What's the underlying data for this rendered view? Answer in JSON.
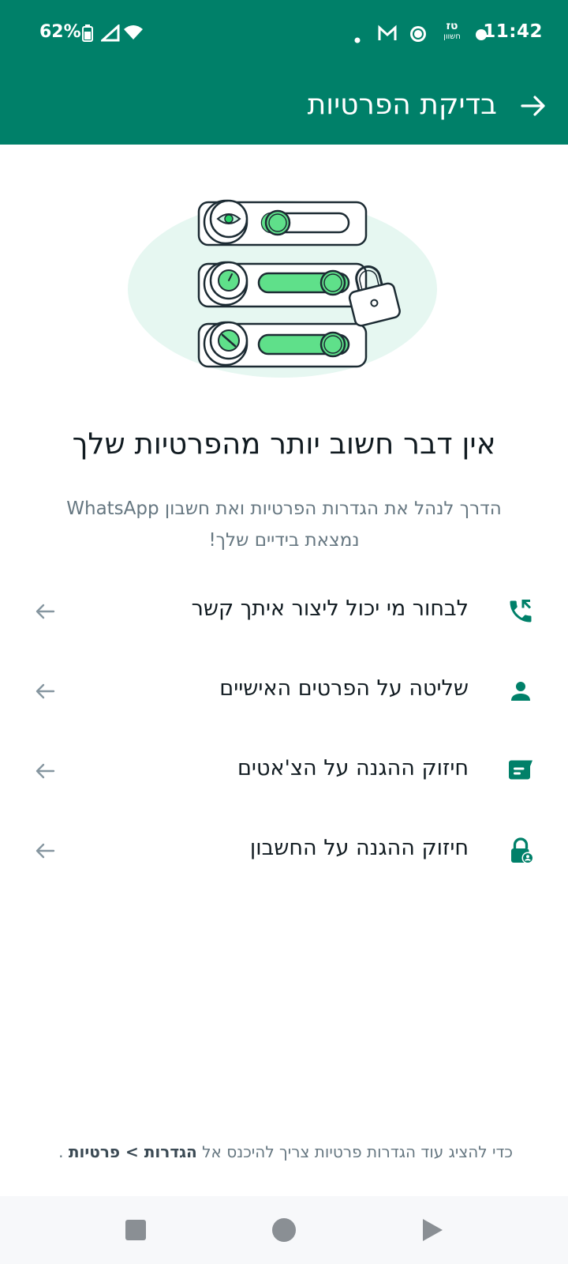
{
  "status_bar": {
    "time": "11:42",
    "battery_percent": "62%",
    "calendar_badge_top": "טז",
    "calendar_badge_bottom": "חשוון"
  },
  "app_bar": {
    "title": "בדיקת הפרטיות"
  },
  "hero": {
    "heading": "אין דבר חשוב יותר מהפרטיות שלך",
    "subheading": "הדרך לנהל את הגדרות הפרטיות ואת חשבון WhatsApp נמצאת בידיים שלך!"
  },
  "options": [
    {
      "label": "לבחור מי יכול ליצור איתך קשר",
      "icon": "phone-contact-icon"
    },
    {
      "label": "שליטה על הפרטים האישיים",
      "icon": "person-icon"
    },
    {
      "label": "חיזוק ההגנה על הצ'אטים",
      "icon": "chat-icon"
    },
    {
      "label": "חיזוק ההגנה על החשבון",
      "icon": "account-lock-icon"
    }
  ],
  "footer": {
    "prefix": "כדי להציג עוד הגדרות פרטיות צריך להיכנס אל",
    "bold_path": "הגדרות > פרטיות",
    "suffix": "."
  },
  "colors": {
    "primary": "#008069",
    "accent": "#00a884",
    "text_secondary": "#667781"
  }
}
